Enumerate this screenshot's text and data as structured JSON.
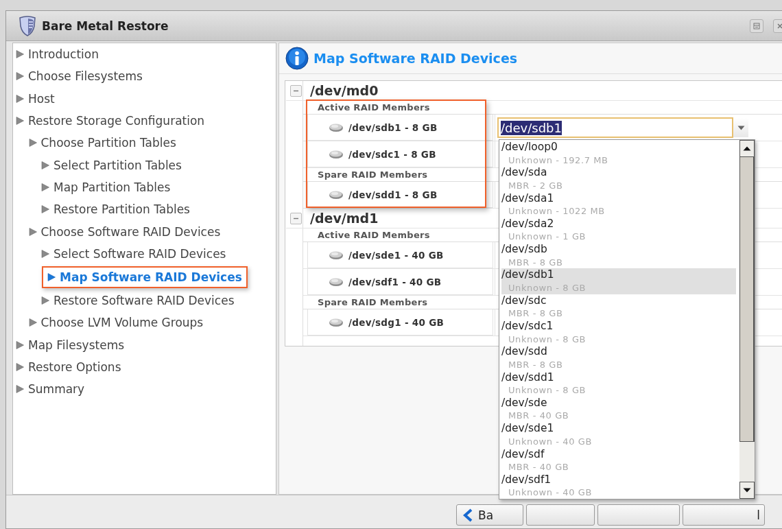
{
  "window": {
    "title": "Bare Metal Restore"
  },
  "nav": {
    "items": [
      {
        "label": "Introduction",
        "selected": false
      },
      {
        "label": "Choose Filesystems",
        "selected": false
      },
      {
        "label": "Host",
        "selected": false
      },
      {
        "label": "Restore Storage Configuration",
        "selected": false,
        "children": [
          {
            "label": "Choose Partition Tables",
            "selected": false,
            "children": [
              {
                "label": "Select Partition Tables",
                "selected": false
              },
              {
                "label": "Map Partition Tables",
                "selected": false
              },
              {
                "label": "Restore Partition Tables",
                "selected": false
              }
            ]
          },
          {
            "label": "Choose Software RAID Devices",
            "selected": false,
            "children": [
              {
                "label": "Select Software RAID Devices",
                "selected": false
              },
              {
                "label": "Map Software RAID Devices",
                "selected": true
              },
              {
                "label": "Restore Software RAID Devices",
                "selected": false
              }
            ]
          },
          {
            "label": "Choose LVM Volume Groups",
            "selected": false
          }
        ]
      },
      {
        "label": "Map Filesystems",
        "selected": false
      },
      {
        "label": "Restore Options",
        "selected": false
      },
      {
        "label": "Summary",
        "selected": false
      }
    ]
  },
  "page_header": {
    "title": "Map Software RAID Devices"
  },
  "raid_devices": [
    {
      "name": "/dev/md0",
      "expanded": true,
      "highlighted": true,
      "sections": [
        {
          "label": "Active RAID Members",
          "members": [
            {
              "label": "/dev/sdb1 - 8 GB",
              "combo": {
                "value": "/dev/sdb1",
                "open": true,
                "options": [
                  {
                    "device": "/dev/loop0",
                    "detail": "Unknown - 192.7 MB",
                    "selected": false
                  },
                  {
                    "device": "/dev/sda",
                    "detail": "MBR - 2 GB",
                    "selected": false
                  },
                  {
                    "device": "/dev/sda1",
                    "detail": "Unknown - 1022 MB",
                    "selected": false
                  },
                  {
                    "device": "/dev/sda2",
                    "detail": "Unknown - 1 GB",
                    "selected": false
                  },
                  {
                    "device": "/dev/sdb",
                    "detail": "MBR - 8 GB",
                    "selected": false
                  },
                  {
                    "device": "/dev/sdb1",
                    "detail": "Unknown - 8 GB",
                    "selected": true
                  },
                  {
                    "device": "/dev/sdc",
                    "detail": "MBR - 8 GB",
                    "selected": false
                  },
                  {
                    "device": "/dev/sdc1",
                    "detail": "Unknown - 8 GB",
                    "selected": false
                  },
                  {
                    "device": "/dev/sdd",
                    "detail": "MBR - 8 GB",
                    "selected": false
                  },
                  {
                    "device": "/dev/sdd1",
                    "detail": "Unknown - 8 GB",
                    "selected": false
                  },
                  {
                    "device": "/dev/sde",
                    "detail": "MBR - 40 GB",
                    "selected": false
                  },
                  {
                    "device": "/dev/sde1",
                    "detail": "Unknown - 40 GB",
                    "selected": false
                  },
                  {
                    "device": "/dev/sdf",
                    "detail": "MBR - 40 GB",
                    "selected": false
                  },
                  {
                    "device": "/dev/sdf1",
                    "detail": "Unknown - 40 GB",
                    "selected": false
                  }
                ]
              }
            },
            {
              "label": "/dev/sdc1 - 8 GB"
            }
          ]
        },
        {
          "label": "Spare RAID Members",
          "members": [
            {
              "label": "/dev/sdd1 - 8 GB"
            }
          ]
        }
      ]
    },
    {
      "name": "/dev/md1",
      "expanded": true,
      "highlighted": false,
      "sections": [
        {
          "label": "Active RAID Members",
          "members": [
            {
              "label": "/dev/sde1 - 40 GB"
            },
            {
              "label": "/dev/sdf1 - 40 GB"
            }
          ]
        },
        {
          "label": "Spare RAID Members",
          "members": [
            {
              "label": "/dev/sdg1 - 40 GB"
            }
          ]
        }
      ]
    }
  ],
  "buttons": [
    {
      "kind": "back",
      "label": "Ba"
    },
    {
      "kind": "next"
    },
    {
      "kind": "finish"
    },
    {
      "kind": "cancel",
      "label": "l"
    }
  ]
}
